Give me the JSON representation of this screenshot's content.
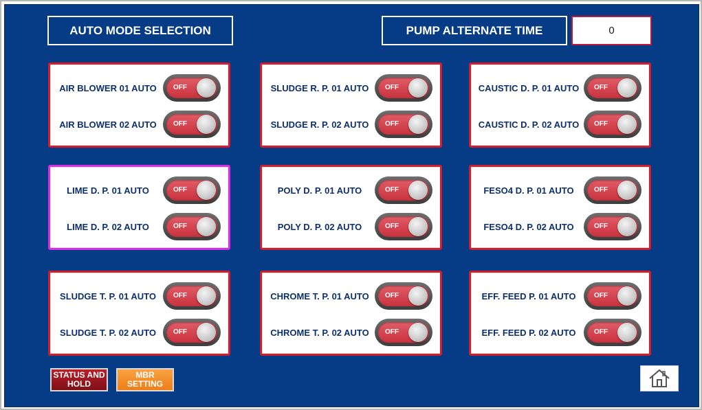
{
  "header": {
    "auto_mode_title": "AUTO MODE SELECTION",
    "pump_alternate_label": "PUMP ALTERNATE TIME",
    "pump_alternate_value": "0"
  },
  "toggle_state": "OFF",
  "panels": [
    {
      "rows": [
        {
          "label": "AIR BLOWER 01 AUTO",
          "state": "OFF"
        },
        {
          "label": "AIR BLOWER 02 AUTO",
          "state": "OFF"
        }
      ]
    },
    {
      "rows": [
        {
          "label": "SLUDGE R. P. 01 AUTO",
          "state": "OFF"
        },
        {
          "label": "SLUDGE R. P. 02 AUTO",
          "state": "OFF"
        }
      ]
    },
    {
      "rows": [
        {
          "label": "CAUSTIC D. P. 01 AUTO",
          "state": "OFF"
        },
        {
          "label": "CAUSTIC D. P. 02 AUTO",
          "state": "OFF"
        }
      ]
    },
    {
      "rows": [
        {
          "label": "LIME D. P. 01 AUTO",
          "state": "OFF"
        },
        {
          "label": "LIME D. P. 02 AUTO",
          "state": "OFF"
        }
      ]
    },
    {
      "rows": [
        {
          "label": "POLY D. P. 01 AUTO",
          "state": "OFF"
        },
        {
          "label": "POLY D. P. 02 AUTO",
          "state": "OFF"
        }
      ]
    },
    {
      "rows": [
        {
          "label": "FESO4 D. P. 01 AUTO",
          "state": "OFF"
        },
        {
          "label": "FESO4 D. P. 02 AUTO",
          "state": "OFF"
        }
      ]
    },
    {
      "rows": [
        {
          "label": "SLUDGE T. P. 01 AUTO",
          "state": "OFF"
        },
        {
          "label": "SLUDGE T. P. 02 AUTO",
          "state": "OFF"
        }
      ]
    },
    {
      "rows": [
        {
          "label": "CHROME T. P. 01 AUTO",
          "state": "OFF"
        },
        {
          "label": "CHROME T. P. 02 AUTO",
          "state": "OFF"
        }
      ]
    },
    {
      "rows": [
        {
          "label": "EFF. FEED P. 01 AUTO",
          "state": "OFF"
        },
        {
          "label": "EFF. FEED P. 02 AUTO",
          "state": "OFF"
        }
      ]
    }
  ],
  "footer": {
    "status_button": {
      "line1": "STATUS AND",
      "line2": "HOLD"
    },
    "mbr_button": {
      "line1": "MBR",
      "line2": "SETTING"
    },
    "home_icon": "home-icon"
  },
  "colors": {
    "background": "#063c86",
    "panel_border": "#d21d2f",
    "selected_panel_border": "#d92de5",
    "toggle_off": "#d9444f",
    "label_text": "#0d2f6e"
  }
}
